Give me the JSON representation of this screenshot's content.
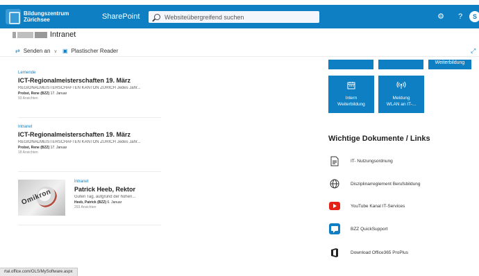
{
  "suitebar": {
    "org_line1": "Bildungszentrum",
    "org_line2": "Zürichsee",
    "app": "SharePoint",
    "search_placeholder": "Websiteübergreifend suchen",
    "help": "?",
    "avatar": "S"
  },
  "site": {
    "title": "Intranet"
  },
  "commandbar": {
    "send": "Senden an",
    "reader": "Plastischer Reader"
  },
  "news": [
    {
      "category": "Lernende",
      "title": "ICT-Regionalmeisterschaften 19. März",
      "desc": "REGIONALMEISTERSCHAFTEN KANTON ZÜRICH Jedes Jahr...",
      "author": "Probst, Rene (BZZ)",
      "date": "17. Januar",
      "views": "93 Ansichten"
    },
    {
      "category": "Intranet",
      "title": "ICT-Regionalmeisterschaften 19. März",
      "desc": "REGIONALMEISTERSCHAFTEN KANTON ZÜRICH Jedes Jahr...",
      "author": "Probst, Rene (BZZ)",
      "date": "17. Januar",
      "views": "18 Ansichten"
    },
    {
      "category": "Intranet",
      "title": "Patrick Heeb, Rektor",
      "desc": "Guten Tag, aufgrund der hohen...",
      "author": "Heeb, Patrick (BZZ)",
      "date": "6. Januar",
      "views": "293 Ansichten",
      "thumb_text": "Omikron"
    }
  ],
  "tiles": {
    "top3_label": "Weiterbildung",
    "big": [
      {
        "line1": "Intern",
        "line2": "Weiterbildung",
        "icon": "calendar-icon"
      },
      {
        "line1": "Meldung",
        "line2": "WLAN an IT-...",
        "icon": "wifi-icon"
      }
    ]
  },
  "documents": {
    "title": "Wichtige Dokumente / Links",
    "items": [
      {
        "label": "IT- Nutzungsordnung",
        "icon": "document-icon"
      },
      {
        "label": "Disziplinarreglement Berufsbildung",
        "icon": "globe-icon"
      },
      {
        "label": "YouTube Kanal IT-Services",
        "icon": "youtube-icon"
      },
      {
        "label": "BZZ QuickSupport",
        "icon": "quicksupport-icon"
      },
      {
        "label": "Download Office365 ProPlus",
        "icon": "office-icon"
      }
    ]
  },
  "status": {
    "url": "rtal.office.com/OLS/MySoftware.aspx"
  },
  "colors": {
    "accent": "#0f7fc3",
    "youtube": "#e62117"
  }
}
